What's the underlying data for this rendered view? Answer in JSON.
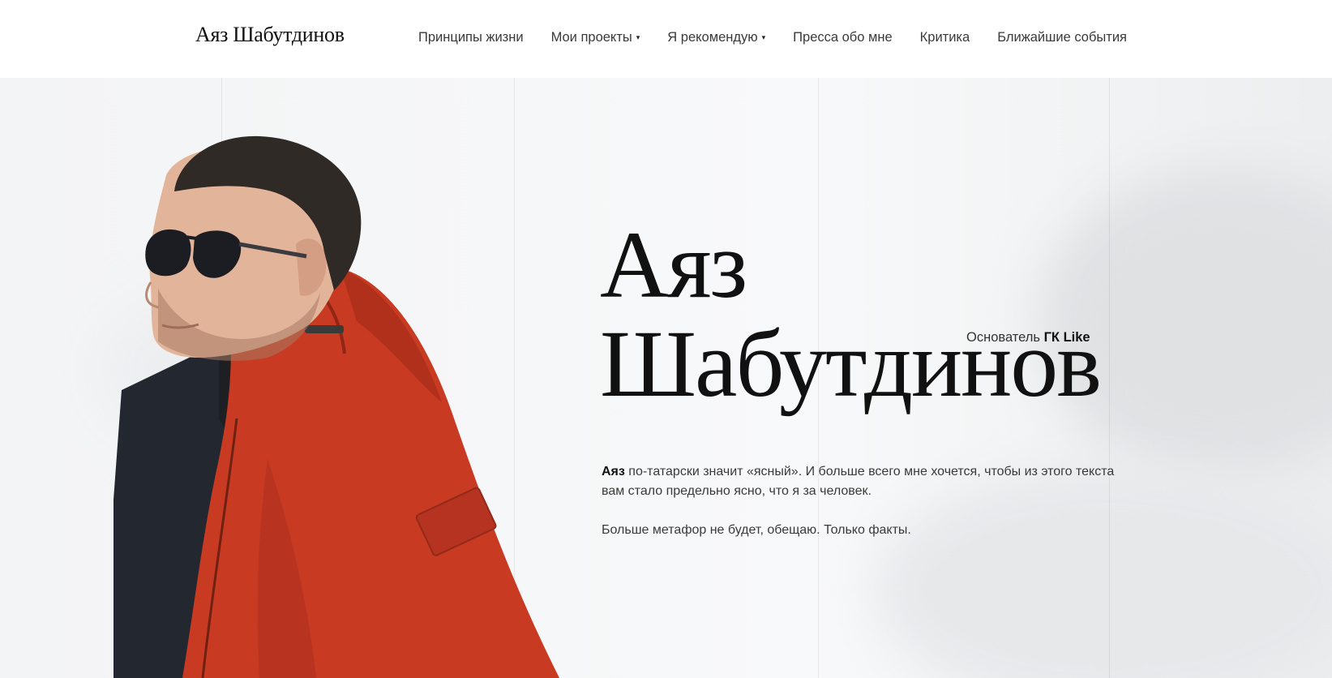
{
  "header": {
    "logo": "Аяз Шабутдинов",
    "nav": [
      {
        "label": "Принципы жизни",
        "dropdown": false
      },
      {
        "label": "Мои проекты",
        "dropdown": true
      },
      {
        "label": "Я рекомендую",
        "dropdown": true
      },
      {
        "label": "Пресса обо мне",
        "dropdown": false
      },
      {
        "label": "Критика",
        "dropdown": false
      },
      {
        "label": "Ближайшие события",
        "dropdown": false
      }
    ],
    "caret": "▾"
  },
  "hero": {
    "title_line1": "Аяз",
    "title_line2": "Шабутдинов",
    "founder_prefix": "Основатель",
    "founder_company": "ГК Like",
    "intro_name": "Аяз",
    "intro_text": " по-татарски значит «ясный». И больше всего мне хочется, чтобы из этого текста вам стало предельно ясно, что я за человек.",
    "intro_text2": "Больше метафор не будет, обещаю. Только факты."
  },
  "colors": {
    "jacket": "#c83a22",
    "inner_jacket": "#23272f",
    "hair": "#2f2a26",
    "skin": "#e2b49a",
    "text": "#111111"
  }
}
